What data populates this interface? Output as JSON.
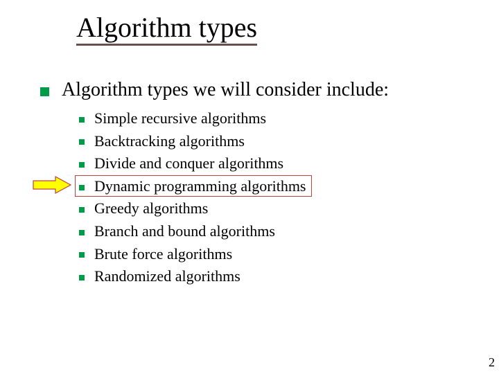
{
  "title": "Algorithm types",
  "main_point": "Algorithm types we will consider include:",
  "items": [
    "Simple recursive algorithms",
    "Backtracking algorithms",
    "Divide and conquer algorithms",
    "Dynamic programming algorithms",
    "Greedy algorithms",
    "Branch and bound algorithms",
    "Brute force algorithms",
    "Randomized algorithms"
  ],
  "highlight_index": 3,
  "page_number": "2",
  "colors": {
    "bullet": "#009a49",
    "title_underline": "#66524a",
    "highlight_border": "#c04040",
    "arrow_fill": "#ffff00",
    "arrow_stroke": "#c04040"
  }
}
